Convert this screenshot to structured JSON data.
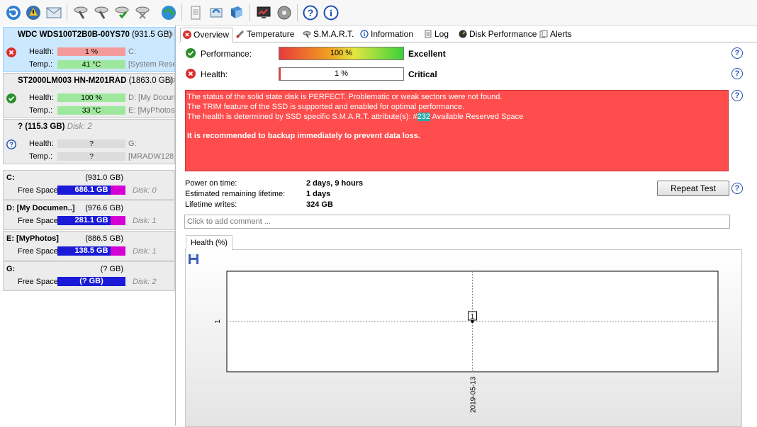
{
  "toolbar": {
    "icons": [
      "refresh-icon",
      "alert-icon",
      "mail-icon",
      "disk-tool-icon",
      "disk-tool-icon",
      "disk-check-icon",
      "disk-tool-icon",
      "globe-icon",
      "document-icon",
      "sync-icon",
      "drive-icon",
      "monitor-chart-icon",
      "disk-gear-icon",
      "help-icon",
      "info-icon"
    ]
  },
  "disks": [
    {
      "name": "WDC  WDS100T2B0B-00YS70",
      "size": "(931.5 GB)",
      "cut": "D",
      "status": "critical",
      "health_label": "Health:",
      "health": "1 %",
      "health_value": 1,
      "temp_label": "Temp.:",
      "temp": "41 °C",
      "side1": "C:",
      "side2": "[System Rese"
    },
    {
      "name": "ST2000LM003 HN-M201RAD",
      "size": "(1863.0 GB)",
      "cut": "D",
      "status": "ok",
      "health_label": "Health:",
      "health": "100 %",
      "health_value": 100,
      "temp_label": "Temp.:",
      "temp": "33 °C",
      "side1": "D: [My Docum",
      "side2": "E: [MyPhotos"
    },
    {
      "name": "? (115.3 GB)",
      "disk_tag": "Disk: 2",
      "status": "unknown",
      "health_label": "Health:",
      "health": "?",
      "temp_label": "Temp.:",
      "temp": "?",
      "side1": "G:",
      "side2": "[MRADW128"
    }
  ],
  "volumes": [
    {
      "name": "C:",
      "size": "(931.0 GB)",
      "free_label": "Free Space",
      "free": "686.1 GB",
      "disk": "Disk: 0",
      "fill": 0.74
    },
    {
      "name": "D: [My Documen..]",
      "size": "(976.6 GB)",
      "free_label": "Free Space",
      "free": "281.1 GB",
      "disk": "Disk: 1",
      "fill": 0.29
    },
    {
      "name": "E: [MyPhotos]",
      "size": "(886.5 GB)",
      "free_label": "Free Space",
      "free": "138.5 GB",
      "disk": "Disk: 1",
      "fill": 0.16
    },
    {
      "name": "G:",
      "size": "(? GB)",
      "free_label": "Free Space",
      "free": "(? GB)",
      "disk": "Disk: 2",
      "fill": 1.0
    }
  ],
  "tabs": [
    {
      "label": "Overview",
      "icon": "error-icon",
      "active": true
    },
    {
      "label": "Temperature",
      "icon": "thermometer-icon"
    },
    {
      "label": "S.M.A.R.T.",
      "icon": "smart-icon"
    },
    {
      "label": "Information",
      "icon": "info-icon"
    },
    {
      "label": "Log",
      "icon": "log-icon"
    },
    {
      "label": "Disk Performance",
      "icon": "performance-icon"
    },
    {
      "label": "Alerts",
      "icon": "alerts-icon"
    }
  ],
  "overview": {
    "performance_label": "Performance:",
    "performance_value": "100 %",
    "performance": 100,
    "performance_rating": "Excellent",
    "health_label": "Health:",
    "health_value": "1 %",
    "health": 1,
    "health_rating": "Critical",
    "message": {
      "line1": "The status of the solid state disk is PERFECT. Problematic or weak sectors were not found.",
      "line2": "The TRIM feature of the SSD is supported and enabled for optimal performance.",
      "line3_pre": "The health is determined by SSD specific S.M.A.R.T. attribute(s):  #",
      "line3_hl": "232",
      "line3_post": " Available Reserved Space",
      "warning": "It is recommended to backup immediately to prevent data loss."
    },
    "power_on_label": "Power on time:",
    "power_on": "2 days, 9 hours",
    "remaining_label": "Estimated remaining lifetime:",
    "remaining": "1 days",
    "writes_label": "Lifetime writes:",
    "writes": "324 GB",
    "repeat_button": "Repeat Test",
    "comment_placeholder": "Click to add comment ..."
  },
  "health_tab": {
    "label": "Health (%)"
  },
  "chart_data": {
    "type": "line",
    "x": [
      "2019-05-13"
    ],
    "series": [
      {
        "values": [
          1
        ]
      }
    ],
    "data_labels": [
      "1"
    ],
    "y_tick_labels": [
      "1"
    ],
    "x_tick_labels": [
      "2019-05-13"
    ],
    "grid": true
  }
}
